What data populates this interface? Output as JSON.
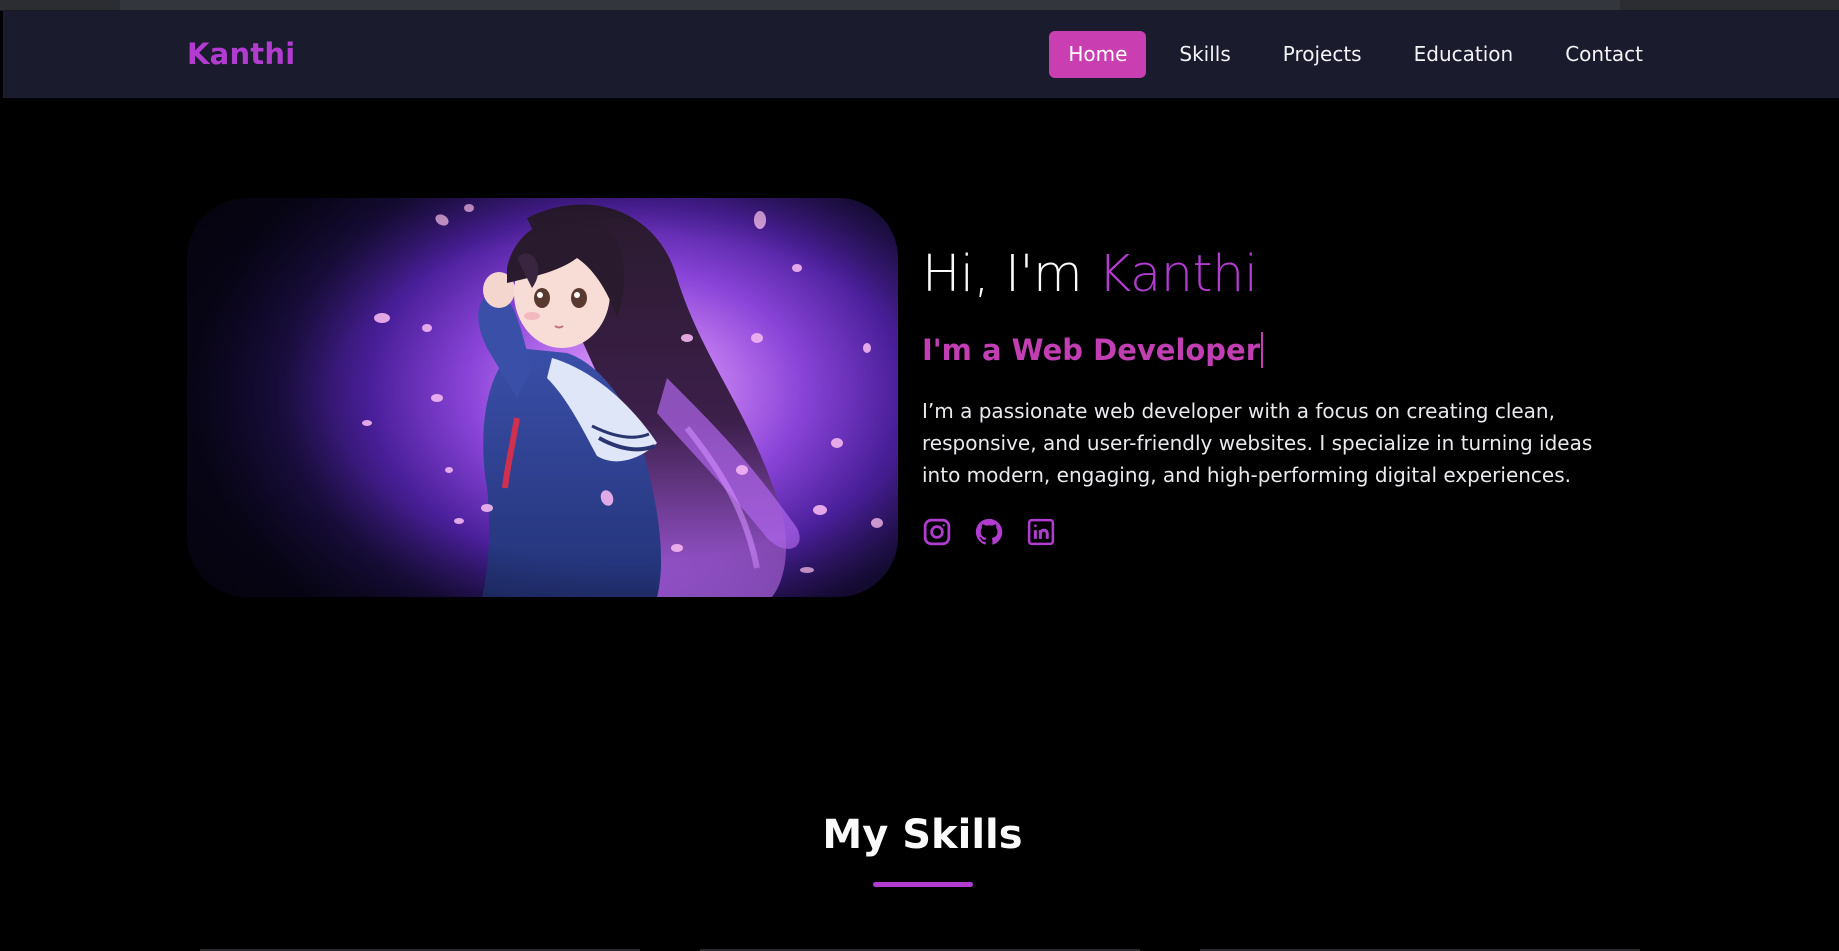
{
  "colors": {
    "accent": "#b23cd0",
    "accent_pink": "#c93fb2",
    "nav_background": "#1b1b2e",
    "page_background": "#000000",
    "text": "#fafafa"
  },
  "nav": {
    "brand": "Kanthi",
    "links": [
      {
        "label": "Home",
        "active": true
      },
      {
        "label": "Skills",
        "active": false
      },
      {
        "label": "Projects",
        "active": false
      },
      {
        "label": "Education",
        "active": false
      },
      {
        "label": "Contact",
        "active": false
      }
    ]
  },
  "hero": {
    "greeting_prefix": "Hi, I'm ",
    "greeting_name": "Kanthi",
    "role_text": "I'm a Web Developer",
    "bio": "I’m a passionate web developer with a focus on creating clean, responsive, and user-friendly websites. I specialize in turning ideas into modern, engaging, and high-performing digital experiences.",
    "image_subject": "anime-girl-portrait",
    "socials": [
      {
        "icon": "instagram-icon"
      },
      {
        "icon": "github-icon"
      },
      {
        "icon": "linkedin-icon"
      }
    ]
  },
  "skills": {
    "title": "My Skills"
  }
}
